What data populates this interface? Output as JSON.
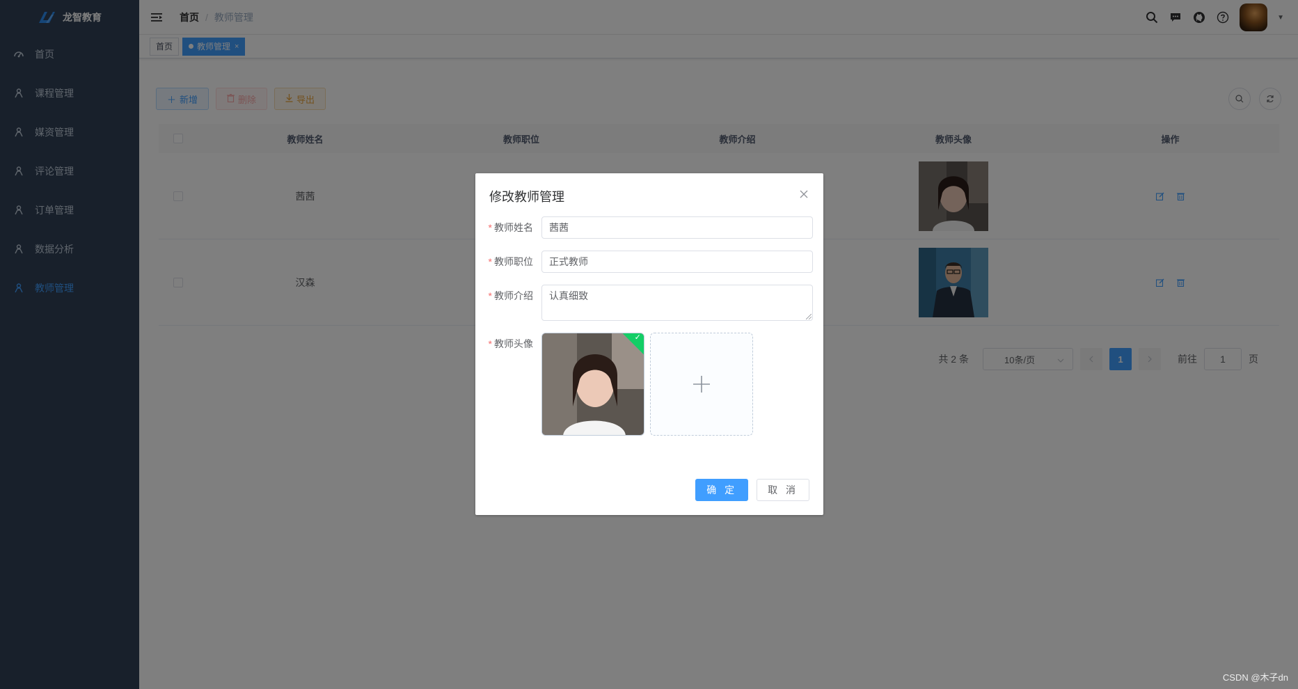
{
  "app": {
    "title": "龙智教育"
  },
  "sidebar": {
    "items": [
      {
        "label": "首页",
        "icon": "dashboard-icon",
        "active": false
      },
      {
        "label": "课程管理",
        "icon": "user-icon",
        "active": false
      },
      {
        "label": "媒资管理",
        "icon": "user-icon",
        "active": false
      },
      {
        "label": "评论管理",
        "icon": "user-icon",
        "active": false
      },
      {
        "label": "订单管理",
        "icon": "user-icon",
        "active": false
      },
      {
        "label": "数据分析",
        "icon": "user-icon",
        "active": false
      },
      {
        "label": "教师管理",
        "icon": "user-icon",
        "active": true
      }
    ]
  },
  "navbar": {
    "breadcrumb": {
      "home": "首页",
      "separator": "/",
      "current": "教师管理"
    }
  },
  "tags": {
    "home": "首页",
    "current": "教师管理",
    "close": "×"
  },
  "toolbar": {
    "add_label": "新增",
    "delete_label": "删除",
    "export_label": "导出"
  },
  "table": {
    "headers": [
      "教师姓名",
      "教师职位",
      "教师介绍",
      "教师头像",
      "操作"
    ],
    "rows": [
      {
        "name": "茜茜",
        "position": "",
        "intro": ""
      },
      {
        "name": "汉森",
        "position": "",
        "intro": ""
      }
    ]
  },
  "pagination": {
    "total_label": "共 2 条",
    "page_size": "10条/页",
    "current_page": "1",
    "goto_label": "前往",
    "goto_value": "1",
    "page_suffix": "页"
  },
  "dialog": {
    "title": "修改教师管理",
    "required_mark": "*",
    "fields": {
      "name_label": "教师姓名",
      "name_value": "茜茜",
      "position_label": "教师职位",
      "position_value": "正式教师",
      "intro_label": "教师介绍",
      "intro_value": "认真细致",
      "avatar_label": "教师头像"
    },
    "upload_success_mark": "✓",
    "confirm_label": "确 定",
    "cancel_label": "取 消"
  },
  "watermark": "CSDN @木子dn",
  "colors": {
    "sidebar_bg": "#304156",
    "primary": "#409eff",
    "danger": "#f56c6c",
    "warning": "#e6a23c",
    "success": "#13ce66"
  }
}
